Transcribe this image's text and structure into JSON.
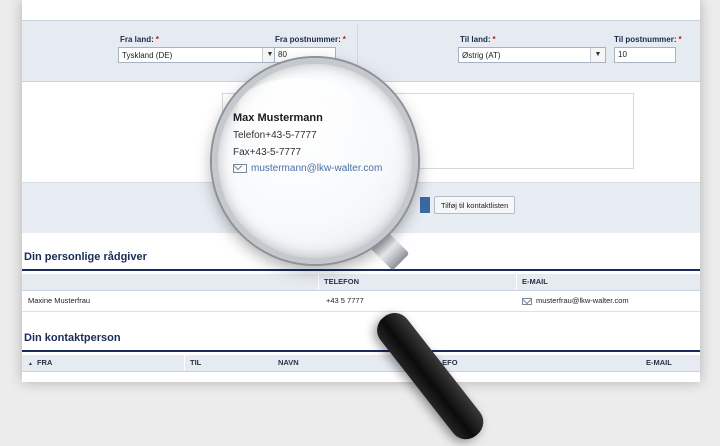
{
  "filters": {
    "from_country_label": "Fra land:",
    "from_country_value": "Tyskland (DE)",
    "from_postal_label": "Fra postnummer:",
    "from_postal_value": "80",
    "to_country_label": "Til land:",
    "to_country_value": "Østrig (AT)",
    "to_postal_label": "Til postnummer:",
    "to_postal_value": "10",
    "required_mark": "*"
  },
  "contact_card": {
    "name": "Max Mustermann",
    "phone": "Telefon+43-5-7777",
    "fax": "Fax+43-5-7777",
    "email": "mustermann@lkw-walter.com"
  },
  "actions": {
    "add_contact_label": "Tilføj til kontaktlisten"
  },
  "advisor_section": {
    "title": "Din personlige rådgiver",
    "columns": [
      "TELEFON",
      "E-MAIL"
    ],
    "rows": [
      {
        "name": "Maxine Musterfrau",
        "phone": "+43 5 7777",
        "email": "musterfrau@lkw-walter.com"
      }
    ]
  },
  "contact_section": {
    "title": "Din kontaktperson",
    "columns": [
      "FRA",
      "TIL",
      "NAVN",
      "TELEFO",
      "E-MAIL"
    ]
  },
  "icons": {
    "mail": "mail-icon",
    "dropdown": "chevron-down-icon",
    "sort": "sort-up-icon"
  },
  "colors": {
    "heading": "#1b2b59",
    "filter_bg": "#e6ebf2",
    "required": "#c0151c",
    "link": "#4a6fa5"
  }
}
